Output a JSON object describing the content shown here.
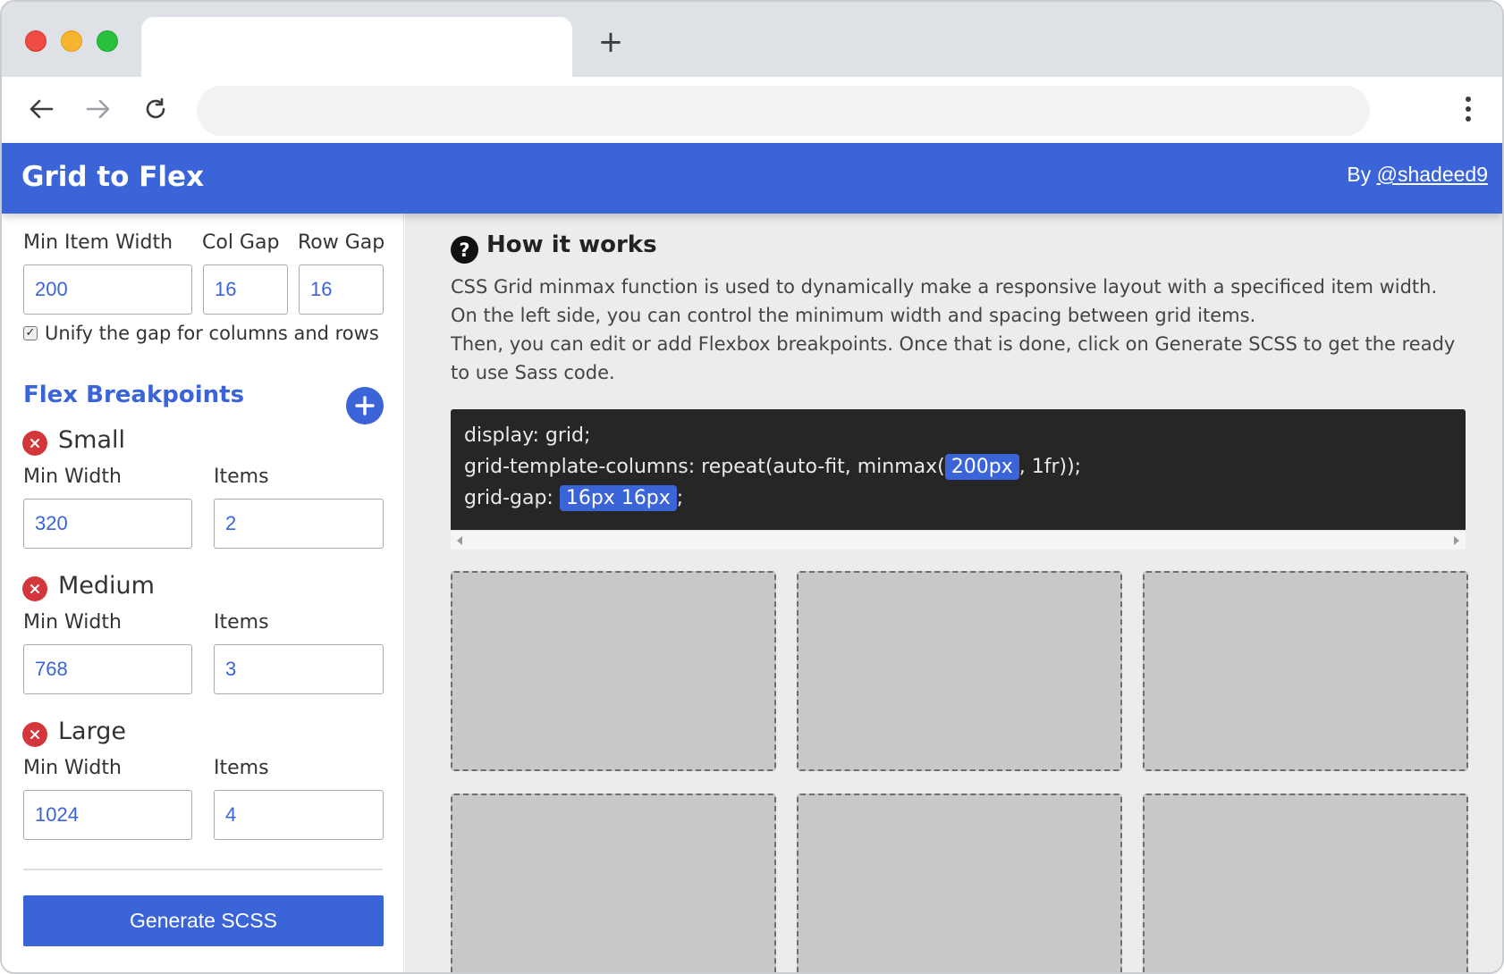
{
  "browser": {
    "new_tab_symbol": "+"
  },
  "header": {
    "title": "Grid to Flex",
    "by_prefix": "By",
    "author_link": "@shadeed9"
  },
  "sidebar": {
    "grid_settings": {
      "min_item_width_label": "Min Item Width",
      "col_gap_label": "Col Gap",
      "row_gap_label": "Row Gap",
      "min_item_width_value": "200",
      "col_gap_value": "16",
      "row_gap_value": "16",
      "unify_gap_label": "Unify the gap for columns and rows",
      "unify_gap_checked": true
    },
    "flex_breakpoints_title": "Flex Breakpoints",
    "breakpoints": [
      {
        "name": "Small",
        "min_width_label": "Min Width",
        "items_label": "Items",
        "min_width": "320",
        "items": "2"
      },
      {
        "name": "Medium",
        "min_width_label": "Min Width",
        "items_label": "Items",
        "min_width": "768",
        "items": "3"
      },
      {
        "name": "Large",
        "min_width_label": "Min Width",
        "items_label": "Items",
        "min_width": "1024",
        "items": "4"
      }
    ],
    "generate_button": "Generate SCSS"
  },
  "main": {
    "how_title": "How it works",
    "help_icon_glyph": "?",
    "description_line1": "CSS Grid minmax function is used to dynamically make a responsive layout with a specificed item width. On the left side, you can control the minimum width and spacing between grid items.",
    "description_line2": "Then, you can edit or add Flexbox breakpoints. Once that is done, click on Generate SCSS to get the ready to use Sass code.",
    "code": {
      "line1": "display: grid;",
      "line2_prefix": "grid-template-columns: repeat(auto-fit, minmax(",
      "line2_highlight": "200px",
      "line2_suffix": ", 1fr));",
      "line3_prefix": "grid-gap: ",
      "line3_highlight": "16px 16px",
      "line3_suffix": ";"
    },
    "grid_item_count": 6
  },
  "colors": {
    "accent": "#3b64d9",
    "remove": "#d4373b",
    "code_bg": "#262626",
    "grid_item": "#c8c8c8"
  }
}
